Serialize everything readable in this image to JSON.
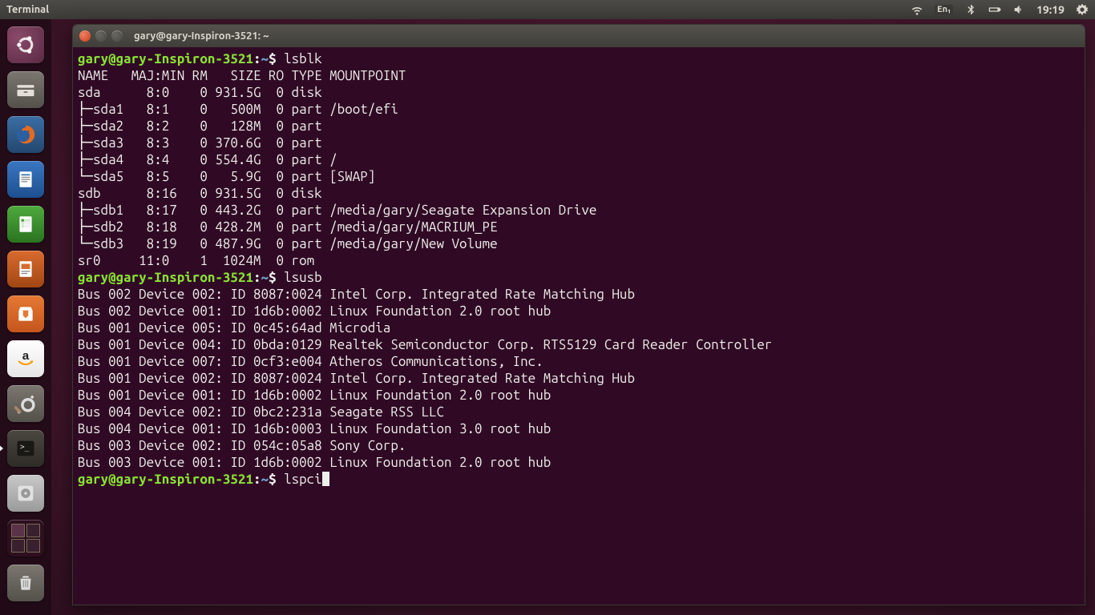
{
  "topbar": {
    "app_title": "Terminal",
    "lang": "En₁",
    "clock": "19:19"
  },
  "launcher": {
    "items": [
      {
        "name": "ubuntu-dash",
        "label": "Dash"
      },
      {
        "name": "files",
        "label": "Files"
      },
      {
        "name": "firefox",
        "label": "Firefox"
      },
      {
        "name": "libreoffice-writer",
        "label": "Writer"
      },
      {
        "name": "libreoffice-calc",
        "label": "Calc"
      },
      {
        "name": "libreoffice-impress",
        "label": "Impress"
      },
      {
        "name": "ubuntu-software",
        "label": "Software"
      },
      {
        "name": "amazon",
        "label": "Amazon"
      },
      {
        "name": "system-settings",
        "label": "Settings"
      },
      {
        "name": "terminal",
        "label": "Terminal",
        "active": true
      },
      {
        "name": "disks",
        "label": "Disks"
      },
      {
        "name": "workspace-switcher",
        "label": "Workspace"
      },
      {
        "name": "trash",
        "label": "Trash"
      }
    ]
  },
  "window": {
    "title": "gary@gary-Inspiron-3521: ~"
  },
  "terminal": {
    "prompt_user_host": "gary@gary-Inspiron-3521",
    "prompt_path": "~",
    "prompt_symbol": "$",
    "cmd1": "lsblk",
    "lsblk_header": "NAME   MAJ:MIN RM   SIZE RO TYPE MOUNTPOINT",
    "lsblk_rows": [
      "sda      8:0    0 931.5G  0 disk ",
      "├─sda1   8:1    0   500M  0 part /boot/efi",
      "├─sda2   8:2    0   128M  0 part ",
      "├─sda3   8:3    0 370.6G  0 part ",
      "├─sda4   8:4    0 554.4G  0 part /",
      "└─sda5   8:5    0   5.9G  0 part [SWAP]",
      "sdb      8:16   0 931.5G  0 disk ",
      "├─sdb1   8:17   0 443.2G  0 part /media/gary/Seagate Expansion Drive",
      "├─sdb2   8:18   0 428.2M  0 part /media/gary/MACRIUM_PE",
      "└─sdb3   8:19   0 487.9G  0 part /media/gary/New Volume",
      "sr0     11:0    1  1024M  0 rom  "
    ],
    "cmd2": "lsusb",
    "lsusb_rows": [
      "Bus 002 Device 002: ID 8087:0024 Intel Corp. Integrated Rate Matching Hub",
      "Bus 002 Device 001: ID 1d6b:0002 Linux Foundation 2.0 root hub",
      "Bus 001 Device 005: ID 0c45:64ad Microdia ",
      "Bus 001 Device 004: ID 0bda:0129 Realtek Semiconductor Corp. RTS5129 Card Reader Controller",
      "Bus 001 Device 007: ID 0cf3:e004 Atheros Communications, Inc. ",
      "Bus 001 Device 002: ID 8087:0024 Intel Corp. Integrated Rate Matching Hub",
      "Bus 001 Device 001: ID 1d6b:0002 Linux Foundation 2.0 root hub",
      "Bus 004 Device 002: ID 0bc2:231a Seagate RSS LLC ",
      "Bus 004 Device 001: ID 1d6b:0003 Linux Foundation 3.0 root hub",
      "Bus 003 Device 002: ID 054c:05a8 Sony Corp. ",
      "Bus 003 Device 001: ID 1d6b:0002 Linux Foundation 2.0 root hub"
    ],
    "cmd3": "lspci"
  }
}
